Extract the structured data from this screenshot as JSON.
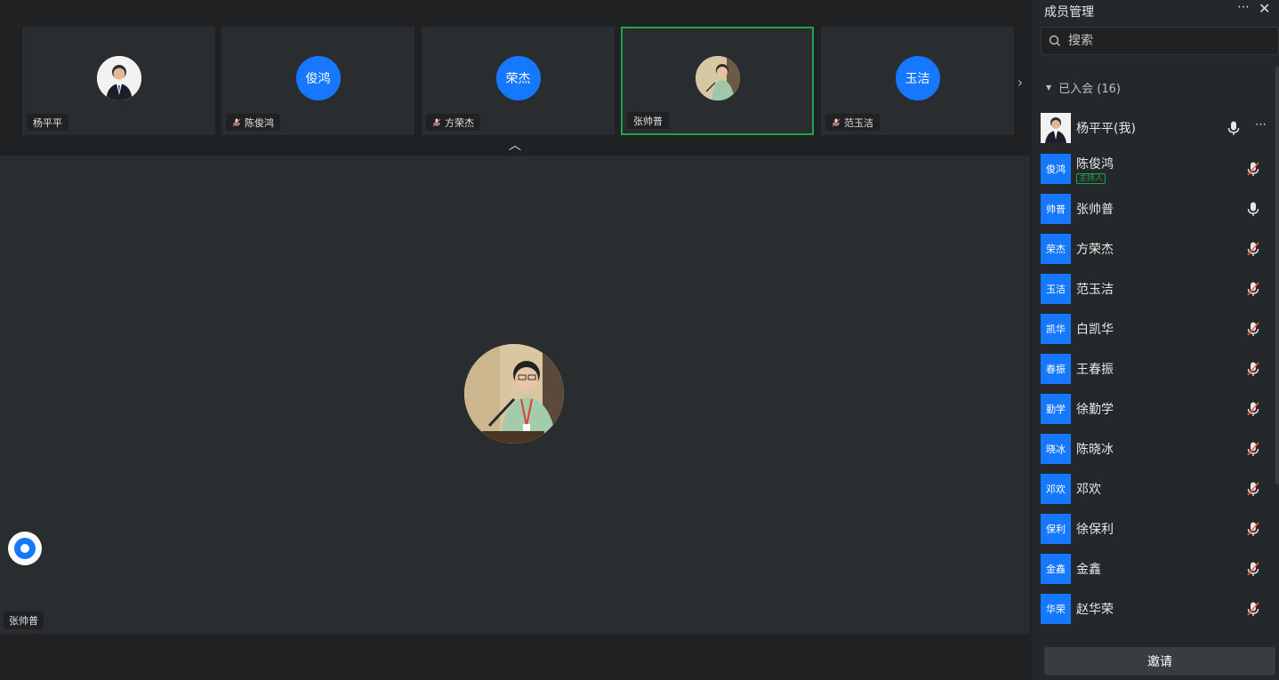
{
  "tiles": [
    {
      "name": "杨平平",
      "avatar_text": "",
      "photo": true,
      "mic_off": false,
      "active": false
    },
    {
      "name": "陈俊鸿",
      "avatar_text": "俊鸿",
      "photo": false,
      "mic_off": true,
      "active": false
    },
    {
      "name": "方荣杰",
      "avatar_text": "荣杰",
      "photo": false,
      "mic_off": true,
      "active": false
    },
    {
      "name": "张帅普",
      "avatar_text": "",
      "photo": true,
      "mic_off": false,
      "active": true
    },
    {
      "name": "范玉洁",
      "avatar_text": "玉洁",
      "photo": false,
      "mic_off": true,
      "active": false
    }
  ],
  "main": {
    "speaker_name": "张帅普"
  },
  "panel": {
    "title": "成员管理",
    "search_placeholder": "搜索",
    "section_label": "已入会 (16)",
    "invite_label": "邀请",
    "members": [
      {
        "name": "杨平平(我)",
        "avatar_text": "",
        "photo": true,
        "mic": "on",
        "host": false,
        "self": true
      },
      {
        "name": "陈俊鸿",
        "avatar_text": "俊鸿",
        "photo": false,
        "mic": "off",
        "host": true,
        "host_label": "主持人"
      },
      {
        "name": "张帅普",
        "avatar_text": "帅普",
        "photo": false,
        "mic": "on",
        "host": false
      },
      {
        "name": "方荣杰",
        "avatar_text": "荣杰",
        "photo": false,
        "mic": "off",
        "host": false
      },
      {
        "name": "范玉洁",
        "avatar_text": "玉洁",
        "photo": false,
        "mic": "off",
        "host": false
      },
      {
        "name": "白凯华",
        "avatar_text": "凯华",
        "photo": false,
        "mic": "off",
        "host": false
      },
      {
        "name": "王春振",
        "avatar_text": "春振",
        "photo": false,
        "mic": "off",
        "host": false
      },
      {
        "name": "徐勤学",
        "avatar_text": "勤学",
        "photo": false,
        "mic": "off",
        "host": false
      },
      {
        "name": "陈晓冰",
        "avatar_text": "晓冰",
        "photo": false,
        "mic": "off",
        "host": false
      },
      {
        "name": "邓欢",
        "avatar_text": "邓欢",
        "photo": false,
        "mic": "off",
        "host": false
      },
      {
        "name": "徐保利",
        "avatar_text": "保利",
        "photo": false,
        "mic": "off",
        "host": false
      },
      {
        "name": "金鑫",
        "avatar_text": "金鑫",
        "photo": false,
        "mic": "off",
        "host": false
      },
      {
        "name": "赵华荣",
        "avatar_text": "华荣",
        "photo": false,
        "mic": "off",
        "host": false
      }
    ]
  },
  "colors": {
    "accent": "#1677ff",
    "active_border": "#1ea54a"
  }
}
